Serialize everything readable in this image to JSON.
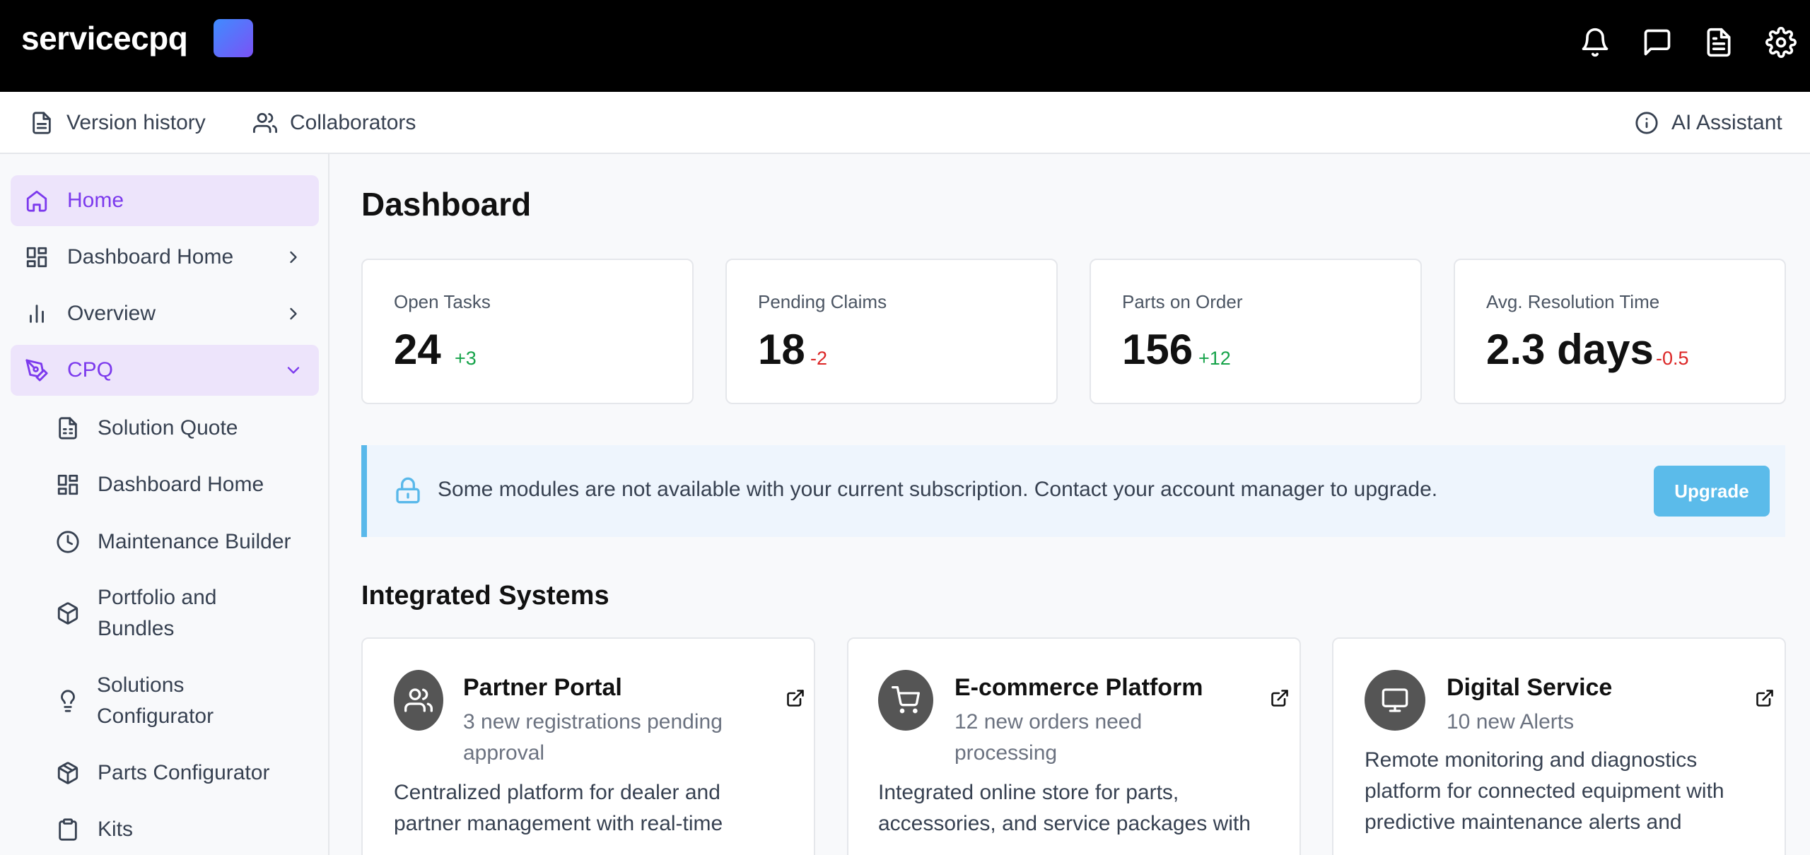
{
  "app": {
    "brand": "servicecpq",
    "brand_color": "#6366f1"
  },
  "topbar": {
    "icons": [
      "bell-icon",
      "chat-icon",
      "document-icon",
      "gear-icon"
    ]
  },
  "toolbar": {
    "version_history": "Version history",
    "collaborators": "Collaborators",
    "ai_assistant": "AI Assistant"
  },
  "sidebar": {
    "items": [
      {
        "label": "Home",
        "icon": "home-icon",
        "active": true
      },
      {
        "label": "Dashboard Home",
        "icon": "grid-icon",
        "chevron": "right"
      },
      {
        "label": "Overview",
        "icon": "bar-chart-icon",
        "chevron": "right"
      },
      {
        "label": "CPQ",
        "icon": "pen-tool-icon",
        "chevron": "down",
        "active": true
      }
    ],
    "cpq_children": [
      {
        "label": "Solution Quote",
        "icon": "file-spreadsheet-icon"
      },
      {
        "label": "Dashboard Home",
        "icon": "grid-icon"
      },
      {
        "label": "Maintenance Builder",
        "icon": "clock-icon"
      },
      {
        "label": "Portfolio and Bundles",
        "icon": "box-icon"
      },
      {
        "label": "Solutions Configurator",
        "icon": "lightbulb-icon"
      },
      {
        "label": "Parts Configurator",
        "icon": "package-icon"
      },
      {
        "label": "Kits",
        "icon": "clipboard-icon"
      }
    ]
  },
  "main": {
    "title": "Dashboard",
    "stats": [
      {
        "label": "Open Tasks",
        "value": "24",
        "delta": "+3",
        "trend": "up"
      },
      {
        "label": "Pending Claims",
        "value": "18",
        "delta": "-2",
        "trend": "down"
      },
      {
        "label": "Parts on Order",
        "value": "156",
        "delta": "+12",
        "trend": "up"
      },
      {
        "label": "Avg. Resolution Time",
        "value": "2.3 days",
        "delta": "-0.5",
        "trend": "down"
      }
    ],
    "notice": {
      "text": "Some modules are not available with your current subscription. Contact your account manager to upgrade.",
      "button": "Upgrade"
    },
    "section_title": "Integrated Systems",
    "systems": [
      {
        "title": "Partner Portal",
        "subtitle": [
          "3 new registrations pending",
          "approval"
        ],
        "description": "Centralized platform for dealer and partner management with real-time",
        "icon": "users-icon"
      },
      {
        "title": "E-commerce Platform",
        "subtitle": [
          "12 new orders need",
          "processing"
        ],
        "description": "Integrated online store for parts, accessories, and service packages with",
        "icon": "cart-icon"
      },
      {
        "title": "Digital Service",
        "subtitle": [
          "10 new Alerts"
        ],
        "description": "Remote monitoring and diagnostics platform for connected equipment with predictive maintenance alerts and",
        "icon": "monitor-icon"
      }
    ]
  }
}
